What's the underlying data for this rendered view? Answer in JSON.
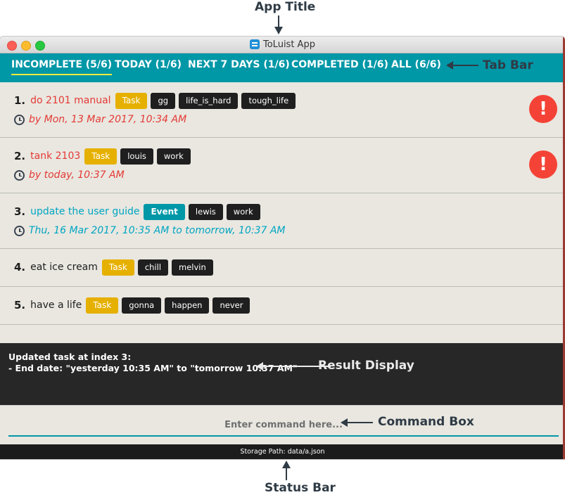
{
  "annotations": {
    "app_title": "App Title",
    "tab_bar": "Tab Bar",
    "result_display": "Result Display",
    "command_box": "Command Box",
    "status_bar": "Status Bar"
  },
  "window": {
    "title": "ToLuist App"
  },
  "tabs": [
    {
      "label": "INCOMPLETE (5/6)",
      "active": true
    },
    {
      "label": "TODAY (1/6)"
    },
    {
      "label": "NEXT 7 DAYS (1/6)"
    },
    {
      "label": "COMPLETED (1/6)"
    },
    {
      "label": "ALL (6/6)"
    }
  ],
  "items": [
    {
      "index": "1.",
      "name": "do 2101 manual",
      "type": "Task",
      "tags": [
        "gg",
        "life_is_hard",
        "tough_life"
      ],
      "date": "by Mon, 13 Mar 2017, 10:34 AM",
      "alert": "!"
    },
    {
      "index": "2.",
      "name": "tank 2103",
      "type": "Task",
      "tags": [
        "louis",
        "work"
      ],
      "date": "by today, 10:37 AM",
      "alert": "!"
    },
    {
      "index": "3.",
      "name": "update the user guide",
      "type": "Event",
      "tags": [
        "lewis",
        "work"
      ],
      "date": "Thu, 16 Mar 2017, 10:35 AM to tomorrow, 10:37 AM"
    },
    {
      "index": "4.",
      "name": "eat ice cream",
      "type": "Task",
      "tags": [
        "chill",
        "melvin"
      ]
    },
    {
      "index": "5.",
      "name": "have a life",
      "type": "Task",
      "tags": [
        "gonna",
        "happen",
        "never"
      ]
    }
  ],
  "result": {
    "line1": "Updated task at index 3:",
    "line2": "- End date: \"yesterday 10:35 AM\" to \"tomorrow 10:37 AM\""
  },
  "command": {
    "placeholder": "Enter command here..."
  },
  "status": {
    "text": "Storage Path: data/a.json"
  },
  "colors": {
    "accent": "#0097a7",
    "overdue": "#e53935",
    "event": "#00a5c2",
    "task_tag": "#e6b000",
    "alert": "#f44336"
  }
}
